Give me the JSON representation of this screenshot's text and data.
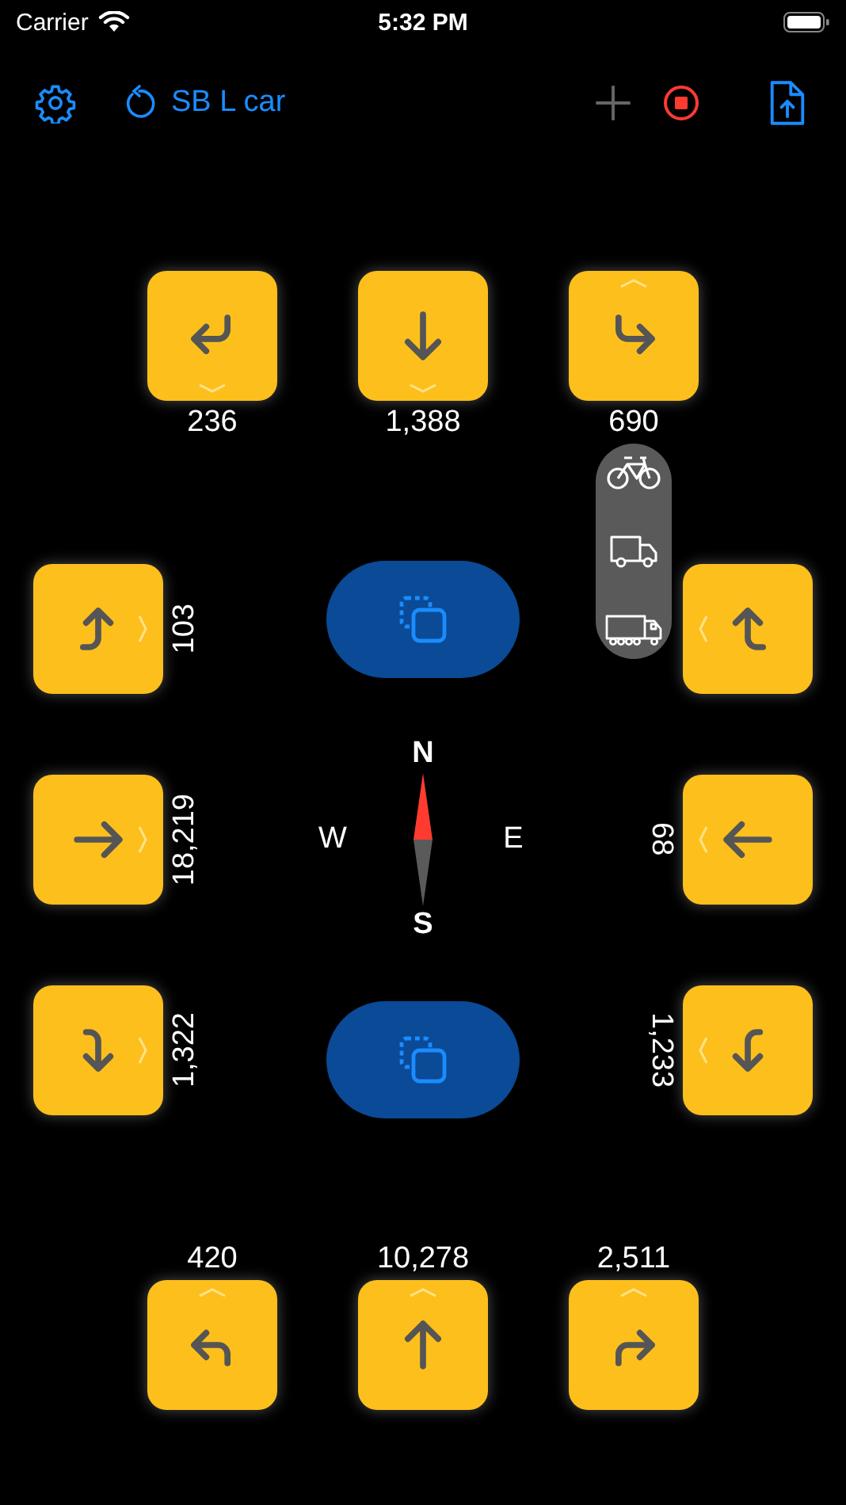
{
  "status_bar": {
    "carrier": "Carrier",
    "time": "5:32 PM"
  },
  "toolbar": {
    "title": "SB L car",
    "add_disabled": true
  },
  "north": [
    {
      "kind": "return-left",
      "chevron": {
        "kind": "down"
      },
      "count": "236"
    },
    {
      "kind": "down",
      "chevron": {
        "kind": "down"
      },
      "count": "1,388"
    },
    {
      "kind": "return-right",
      "chevron": {
        "kind": "up"
      },
      "count": "690"
    }
  ],
  "west": [
    {
      "kind": "turn-up-from-left",
      "chevron": {
        "kind": "right"
      },
      "count": "103"
    },
    {
      "kind": "right",
      "chevron": {
        "kind": "right"
      },
      "count": "18,219"
    },
    {
      "kind": "turn-down-from-left",
      "chevron": {
        "kind": "right"
      },
      "count": "1,322"
    }
  ],
  "east": [
    {
      "kind": "turn-up-from-right",
      "chevron": {
        "kind": "left"
      }
    },
    {
      "kind": "left",
      "chevron": {
        "kind": "left"
      },
      "count": "68"
    },
    {
      "kind": "turn-down-from-right",
      "chevron": {
        "kind": "left"
      },
      "count": "1,233"
    }
  ],
  "south": [
    {
      "kind": "return-left-up",
      "chevron": {
        "kind": "up"
      },
      "count": "420"
    },
    {
      "kind": "up",
      "chevron": {
        "kind": "up"
      },
      "count": "10,278"
    },
    {
      "kind": "return-right-up",
      "chevron": {
        "kind": "up"
      },
      "count": "2,511"
    }
  ],
  "center_buttons": [
    {
      "kind": "copy"
    },
    {
      "kind": "copy"
    }
  ],
  "compass": {
    "n": "N",
    "e": "E",
    "s": "S",
    "w": "W"
  },
  "vehicle_menu": [
    {
      "kind": "bicycle"
    },
    {
      "kind": "van"
    },
    {
      "kind": "truck"
    }
  ]
}
